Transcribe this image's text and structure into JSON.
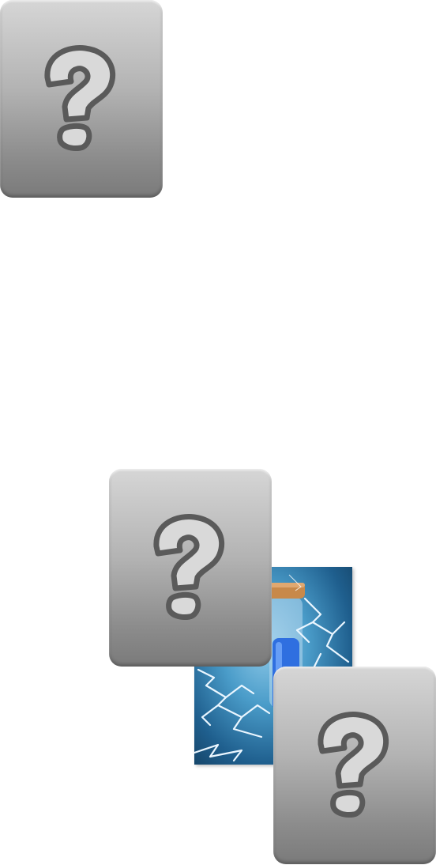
{
  "cards": [
    {
      "state": "hidden",
      "icon": "question-mark-icon"
    },
    {
      "state": "hidden",
      "icon": "question-mark-icon"
    },
    {
      "state": "hidden",
      "icon": "question-mark-icon"
    }
  ],
  "revealed_card": {
    "state": "revealed",
    "icon": "lightning-potion-icon"
  },
  "colors": {
    "card_top": "#d6d6d6",
    "card_bottom": "#7a7a7a",
    "question_fill": "#d9d9d9",
    "question_stroke": "#5a5a5a",
    "spell_background": "#3a8fc4",
    "potion_liquid": "#2f6fe0",
    "potion_cork": "#c8894a"
  }
}
